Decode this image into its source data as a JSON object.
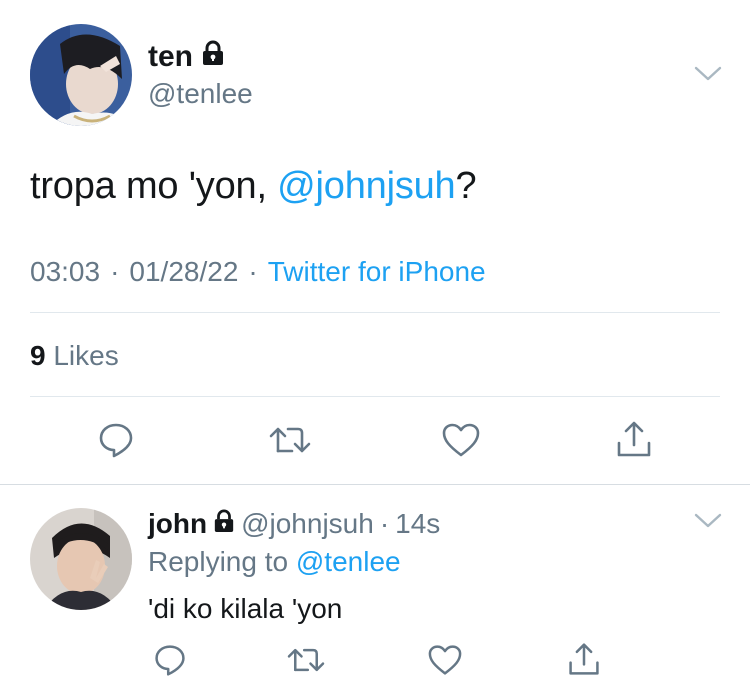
{
  "tweet": {
    "display_name": "ten",
    "handle": "@tenlee",
    "text_before": "tropa mo 'yon, ",
    "text_mention": "@johnjsuh",
    "text_after": "?",
    "time": "03:03",
    "date": "01/28/22",
    "separator": "·",
    "source": "Twitter for iPhone",
    "likes_count": "9",
    "likes_label": "Likes"
  },
  "reply": {
    "display_name": "john",
    "handle": "@johnjsuh",
    "separator": "·",
    "age": "14s",
    "replying_prefix": "Replying to",
    "replying_to": "@tenlee",
    "text": "'di ko kilala 'yon"
  },
  "icons": {
    "reply": "comment-icon",
    "retweet": "retweet-icon",
    "like": "heart-icon",
    "share": "share-icon",
    "protected": "lock-icon",
    "menu": "chevron-down-icon"
  },
  "colors": {
    "accent": "#1da1f2",
    "secondary_text": "#657786",
    "primary_text": "#14171a",
    "divider": "#e1e8ed"
  }
}
